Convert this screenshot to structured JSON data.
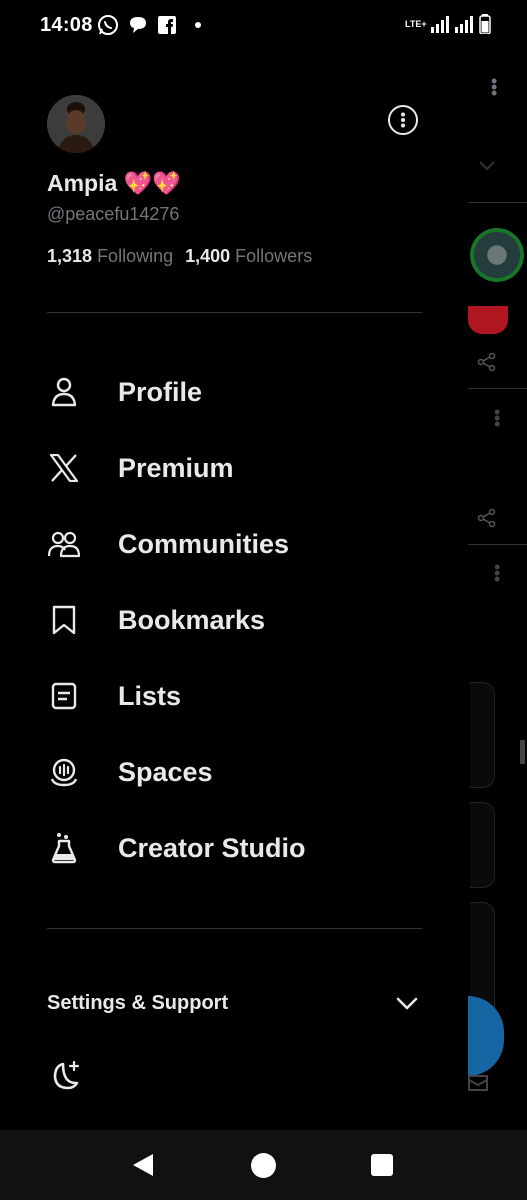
{
  "status_bar": {
    "time": "14:08",
    "left_icons": [
      "whatsapp-icon",
      "chat-bubble-icon",
      "facebook-icon"
    ],
    "network": "LTE+",
    "sim_label": "LTE+",
    "battery": "battery-icon"
  },
  "profile": {
    "display_name": "Ampia 💖💖",
    "handle": "@peacefu14276",
    "following_count": "1,318",
    "following_label": "Following",
    "followers_count": "1,400",
    "followers_label": "Followers"
  },
  "menu": {
    "items": [
      {
        "label": "Profile",
        "icon": "person-icon"
      },
      {
        "label": "Premium",
        "icon": "x-logo-icon"
      },
      {
        "label": "Communities",
        "icon": "communities-icon"
      },
      {
        "label": "Bookmarks",
        "icon": "bookmark-icon"
      },
      {
        "label": "Lists",
        "icon": "list-icon"
      },
      {
        "label": "Spaces",
        "icon": "spaces-icon"
      },
      {
        "label": "Creator Studio",
        "icon": "creator-studio-icon"
      }
    ]
  },
  "footer": {
    "settings_label": "Settings & Support",
    "theme_icon": "moon-icon"
  },
  "colors": {
    "background": "#000000",
    "text": "#e7e9ea",
    "muted": "#71767b",
    "divider": "#2f3336",
    "fab": "#1d9bf0"
  }
}
